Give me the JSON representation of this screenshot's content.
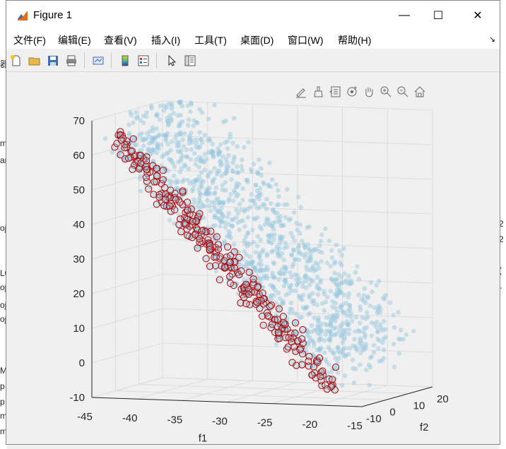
{
  "window": {
    "title": "Figure 1",
    "controls": {
      "minimize": "—",
      "maximize": "☐",
      "close": "✕"
    }
  },
  "menubar": {
    "items": [
      {
        "label": "文件(F)"
      },
      {
        "label": "编辑(E)"
      },
      {
        "label": "查看(V)"
      },
      {
        "label": "插入(I)"
      },
      {
        "label": "工具(T)"
      },
      {
        "label": "桌面(D)"
      },
      {
        "label": "窗口(W)"
      },
      {
        "label": "帮助(H)"
      }
    ],
    "overflow_icon": "arrow-icon"
  },
  "toolbar": {
    "buttons": [
      "new-figure",
      "open-file",
      "save",
      "print",
      "link-plot",
      "insert-colorbar",
      "insert-legend",
      "edit-plot",
      "property-inspector"
    ]
  },
  "axes_toolbar": {
    "buttons": [
      "edit-text",
      "brush",
      "data-tips",
      "rotate-3d",
      "pan",
      "zoom-in",
      "zoom-out",
      "restore-view"
    ]
  },
  "background_fragments": {
    "left": [
      "器",
      "m",
      "ar",
      "oj",
      "L0",
      "oj",
      "oj",
      "oj",
      "M",
      "p",
      "p",
      "m",
      "m"
    ],
    "right": [
      "2",
      "2",
      "(",
      "-"
    ]
  },
  "chart_data": {
    "type": "scatter",
    "title": "",
    "xlabel": "f1",
    "ylabel": "f2",
    "zlabel": "",
    "xlim": [
      -45,
      -15
    ],
    "ylim": [
      -10,
      20
    ],
    "zlim": [
      -10,
      70
    ],
    "xticks": [
      "-45",
      "-40",
      "-35",
      "-30",
      "-25",
      "-20",
      "-15"
    ],
    "yticks": [
      "-10",
      "0",
      "10",
      "20"
    ],
    "zticks": [
      "-10",
      "0",
      "10",
      "20",
      "30",
      "40",
      "50",
      "60",
      "70"
    ],
    "grid": true,
    "view": "3d-rotated",
    "series": [
      {
        "marker": "filled-circle",
        "color": "#92c5de",
        "alpha": 0.45,
        "count": 1200
      },
      {
        "marker": "open-circle",
        "color": "#b30000",
        "count": 300
      }
    ]
  }
}
